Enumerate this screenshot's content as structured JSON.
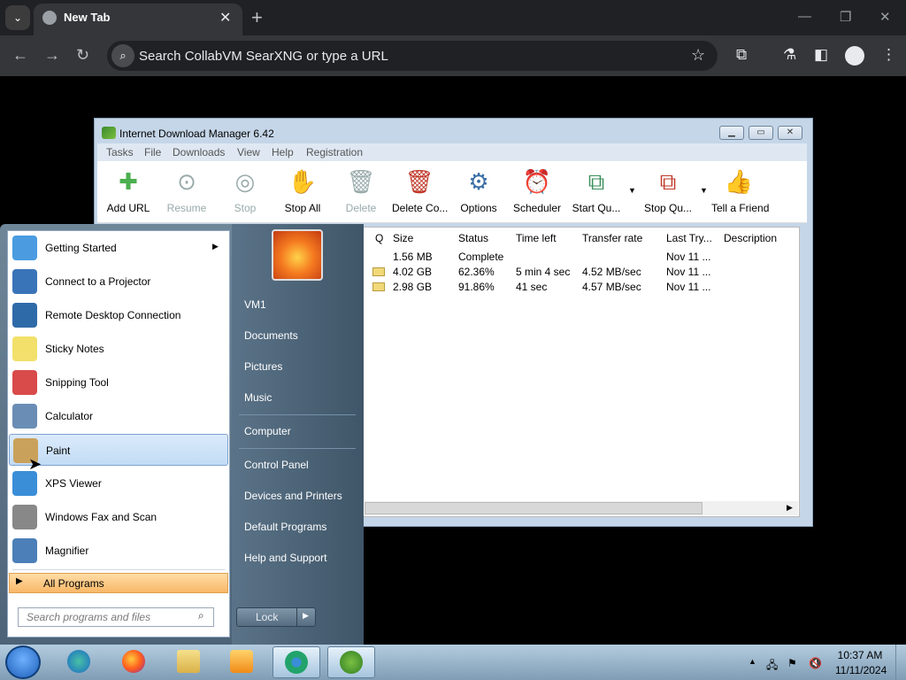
{
  "browser": {
    "tab_title": "New Tab",
    "omnibox_placeholder": "Search CollabVM SearXNG or type a URL"
  },
  "idm": {
    "title": "Internet Download Manager 6.42",
    "menus": [
      "Tasks",
      "File",
      "Downloads",
      "View",
      "Help",
      "Registration"
    ],
    "toolbar": [
      {
        "label": "Add URL",
        "icon": "add-icon",
        "enabled": true
      },
      {
        "label": "Resume",
        "icon": "resume-icon",
        "enabled": false
      },
      {
        "label": "Stop",
        "icon": "stop-icon",
        "enabled": false
      },
      {
        "label": "Stop All",
        "icon": "hand-icon",
        "enabled": true
      },
      {
        "label": "Delete",
        "icon": "trash-icon",
        "enabled": false
      },
      {
        "label": "Delete Co...",
        "icon": "delete-completed-icon",
        "enabled": true
      },
      {
        "label": "Options",
        "icon": "gear-icon",
        "enabled": true
      },
      {
        "label": "Scheduler",
        "icon": "alarm-clock-icon",
        "enabled": true
      },
      {
        "label": "Start Qu...",
        "icon": "start-queue-icon",
        "enabled": true
      },
      {
        "label": "Stop Qu...",
        "icon": "stop-queue-icon",
        "enabled": true
      },
      {
        "label": "Tell a Friend",
        "icon": "thumbs-up-icon",
        "enabled": true
      }
    ],
    "columns": [
      "Q",
      "Size",
      "Status",
      "Time left",
      "Transfer rate",
      "Last Try...",
      "Description"
    ],
    "rows": [
      {
        "size": "1.56  MB",
        "status": "Complete",
        "time_left": "",
        "rate": "",
        "last_try": "Nov 11 ..."
      },
      {
        "size": "4.02  GB",
        "status": "62.36%",
        "time_left": "5 min 4 sec",
        "rate": "4.52  MB/sec",
        "last_try": "Nov 11 ..."
      },
      {
        "size": "2.98  GB",
        "status": "91.86%",
        "time_left": "41 sec",
        "rate": "4.57  MB/sec",
        "last_try": "Nov 11 ..."
      }
    ]
  },
  "start_menu": {
    "programs": [
      {
        "label": "Getting Started",
        "icon": "getting-started-icon",
        "color": "#4a9be0"
      },
      {
        "label": "Connect to a Projector",
        "icon": "projector-icon",
        "color": "#3a74b8"
      },
      {
        "label": "Remote Desktop Connection",
        "icon": "remote-desktop-icon",
        "color": "#2f6aa8"
      },
      {
        "label": "Sticky Notes",
        "icon": "sticky-notes-icon",
        "color": "#f2e06a"
      },
      {
        "label": "Snipping Tool",
        "icon": "scissors-icon",
        "color": "#d94a4a"
      },
      {
        "label": "Calculator",
        "icon": "calculator-icon",
        "color": "#6a8db5"
      },
      {
        "label": "Paint",
        "icon": "paint-palette-icon",
        "color": "#c9a15a"
      },
      {
        "label": "XPS Viewer",
        "icon": "xps-viewer-icon",
        "color": "#3a8ed8"
      },
      {
        "label": "Windows Fax and Scan",
        "icon": "fax-icon",
        "color": "#888"
      },
      {
        "label": "Magnifier",
        "icon": "magnifier-icon",
        "color": "#4c7fb8"
      }
    ],
    "all_programs": "All Programs",
    "search_placeholder": "Search programs and files",
    "right_links": [
      "VM1",
      "Documents",
      "Pictures",
      "Music",
      "Computer",
      "Control Panel",
      "Devices and Printers",
      "Default Programs",
      "Help and Support"
    ],
    "lock_label": "Lock"
  },
  "taskbar": {
    "time": "10:37 AM",
    "date": "11/11/2024"
  }
}
